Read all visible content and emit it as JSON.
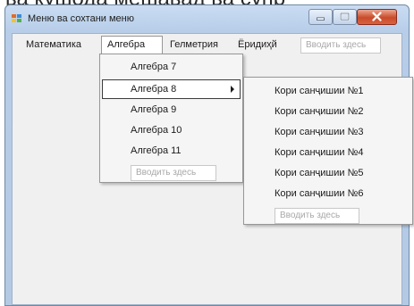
{
  "caption": "ва кушода мешавад ва супр",
  "window": {
    "title": "Меню ва сохтани меню",
    "icon": "app-window-icon",
    "controls": [
      "minimize-icon",
      "maximize-icon",
      "close-icon"
    ]
  },
  "menubar": {
    "items": [
      {
        "label": "Математика"
      },
      {
        "label": "Алгебра"
      },
      {
        "label": "Гелметрия"
      },
      {
        "label": "Ёридиҳй"
      }
    ],
    "type_here": "Вводить здесь"
  },
  "algebra_menu": {
    "items": [
      {
        "label": "Алгебра 7"
      },
      {
        "label": "Алгебра 8"
      },
      {
        "label": "Алгебра 9"
      },
      {
        "label": "Алгебра 10"
      },
      {
        "label": "Алгебра 11"
      }
    ],
    "type_here": "Вводить здесь"
  },
  "algebra8_submenu": {
    "items": [
      {
        "label": "Кори санҷишии №1"
      },
      {
        "label": "Кори санҷишии №2"
      },
      {
        "label": "Кори санҷишии №3"
      },
      {
        "label": "Кори санҷишии №4"
      },
      {
        "label": "Кори санҷишии №5"
      },
      {
        "label": "Кори санҷишии №6"
      }
    ],
    "type_here": "Вводить здесь"
  }
}
